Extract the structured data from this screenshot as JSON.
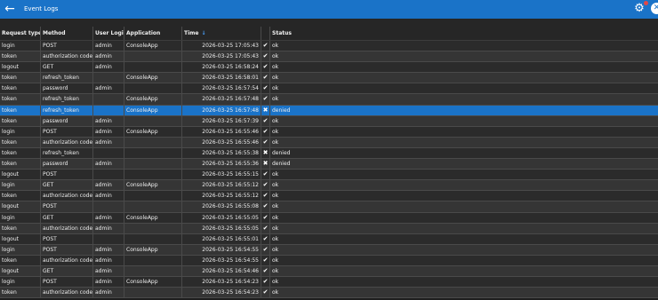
{
  "titlebar": {
    "title": "Event Logs",
    "back_icon": "←",
    "settings_icon": "⚙",
    "close_icon": "✕"
  },
  "columns": {
    "request_type": "Request type",
    "method": "Method",
    "user_login": "User Login",
    "application": "Application",
    "time": "Time",
    "time_sort": "↓",
    "status": "Status"
  },
  "status_icons": {
    "ok": "✔",
    "denied": "✖"
  },
  "rows": [
    {
      "request_type": "login",
      "method": "POST",
      "user_login": "admin",
      "application": "ConsoleApp",
      "time": "2026-03-25 17:05:43",
      "status": "ok"
    },
    {
      "request_type": "token",
      "method": "authorization code",
      "user_login": "admin",
      "application": "",
      "time": "2026-03-25 17:05:43",
      "status": "ok"
    },
    {
      "request_type": "logout",
      "method": "GET",
      "user_login": "admin",
      "application": "",
      "time": "2026-03-25 16:58:24",
      "status": "ok"
    },
    {
      "request_type": "token",
      "method": "refresh_token",
      "user_login": "",
      "application": "ConsoleApp",
      "time": "2026-03-25 16:58:01",
      "status": "ok"
    },
    {
      "request_type": "token",
      "method": "password",
      "user_login": "admin",
      "application": "",
      "time": "2026-03-25 16:57:54",
      "status": "ok"
    },
    {
      "request_type": "token",
      "method": "refresh_token",
      "user_login": "",
      "application": "ConsoleApp",
      "time": "2026-03-25 16:57:48",
      "status": "ok"
    },
    {
      "request_type": "token",
      "method": "refresh_token",
      "user_login": "",
      "application": "ConsoleApp",
      "time": "2026-03-25 16:57:48",
      "status": "denied",
      "selected": true
    },
    {
      "request_type": "token",
      "method": "password",
      "user_login": "admin",
      "application": "",
      "time": "2026-03-25 16:57:39",
      "status": "ok"
    },
    {
      "request_type": "login",
      "method": "POST",
      "user_login": "admin",
      "application": "ConsoleApp",
      "time": "2026-03-25 16:55:46",
      "status": "ok"
    },
    {
      "request_type": "token",
      "method": "authorization code",
      "user_login": "admin",
      "application": "",
      "time": "2026-03-25 16:55:46",
      "status": "ok"
    },
    {
      "request_type": "token",
      "method": "refresh_token",
      "user_login": "",
      "application": "",
      "time": "2026-03-25 16:55:38",
      "status": "denied"
    },
    {
      "request_type": "token",
      "method": "password",
      "user_login": "admin",
      "application": "",
      "time": "2026-03-25 16:55:36",
      "status": "denied"
    },
    {
      "request_type": "logout",
      "method": "POST",
      "user_login": "",
      "application": "",
      "time": "2026-03-25 16:55:15",
      "status": "ok"
    },
    {
      "request_type": "login",
      "method": "GET",
      "user_login": "admin",
      "application": "ConsoleApp",
      "time": "2026-03-25 16:55:12",
      "status": "ok"
    },
    {
      "request_type": "token",
      "method": "authorization code",
      "user_login": "admin",
      "application": "",
      "time": "2026-03-25 16:55:12",
      "status": "ok"
    },
    {
      "request_type": "logout",
      "method": "POST",
      "user_login": "",
      "application": "",
      "time": "2026-03-25 16:55:08",
      "status": "ok"
    },
    {
      "request_type": "login",
      "method": "GET",
      "user_login": "admin",
      "application": "ConsoleApp",
      "time": "2026-03-25 16:55:05",
      "status": "ok"
    },
    {
      "request_type": "token",
      "method": "authorization code",
      "user_login": "admin",
      "application": "",
      "time": "2026-03-25 16:55:05",
      "status": "ok"
    },
    {
      "request_type": "logout",
      "method": "POST",
      "user_login": "",
      "application": "",
      "time": "2026-03-25 16:55:01",
      "status": "ok"
    },
    {
      "request_type": "login",
      "method": "POST",
      "user_login": "admin",
      "application": "ConsoleApp",
      "time": "2026-03-25 16:54:55",
      "status": "ok"
    },
    {
      "request_type": "token",
      "method": "authorization code",
      "user_login": "admin",
      "application": "",
      "time": "2026-03-25 16:54:55",
      "status": "ok"
    },
    {
      "request_type": "logout",
      "method": "GET",
      "user_login": "admin",
      "application": "",
      "time": "2026-03-25 16:54:46",
      "status": "ok"
    },
    {
      "request_type": "login",
      "method": "POST",
      "user_login": "admin",
      "application": "ConsoleApp",
      "time": "2026-03-25 16:54:23",
      "status": "ok"
    },
    {
      "request_type": "token",
      "method": "authorization code",
      "user_login": "admin",
      "application": "",
      "time": "2026-03-25 16:54:23",
      "status": "ok"
    }
  ]
}
